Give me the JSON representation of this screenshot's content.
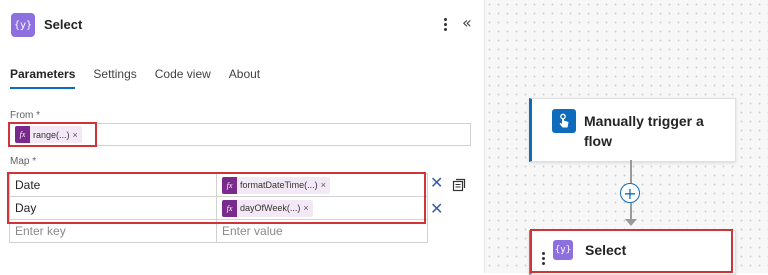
{
  "panel": {
    "title": "Select",
    "icon_glyph": "{y}",
    "collapse_glyph": "«",
    "tabs": [
      {
        "label": "Parameters",
        "active": true
      },
      {
        "label": "Settings",
        "active": false
      },
      {
        "label": "Code view",
        "active": false
      },
      {
        "label": "About",
        "active": false
      }
    ]
  },
  "from": {
    "label": "From *",
    "token": {
      "icon": "fx",
      "text": "range(...)",
      "remove": "×"
    }
  },
  "map": {
    "label": "Map *",
    "rows": [
      {
        "key": "Date",
        "value_token": {
          "icon": "fx",
          "text": "formatDateTime(...)",
          "remove": "×"
        }
      },
      {
        "key": "Day",
        "value_token": {
          "icon": "fx",
          "text": "dayOfWeek(...)",
          "remove": "×"
        }
      }
    ],
    "new_row": {
      "key_placeholder": "Enter key",
      "value_placeholder": "Enter value"
    },
    "delete_glyph": "✕"
  },
  "canvas": {
    "trigger": {
      "label": "Manually trigger a flow"
    },
    "add_glyph": "+",
    "select": {
      "label": "Select",
      "icon_glyph": "{y}"
    }
  },
  "colors": {
    "accent_blue": "#0f6cbd",
    "action_purple": "#8e6fe0",
    "expression_purple": "#7a2a8d",
    "highlight_red": "#d13438"
  }
}
